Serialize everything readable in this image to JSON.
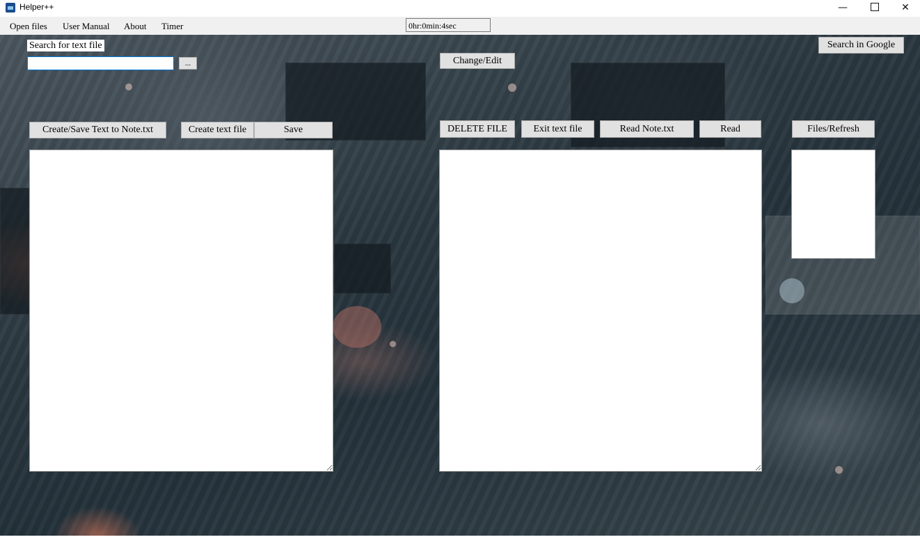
{
  "window": {
    "title": "Helper++",
    "icon": "app-icon",
    "minimize_glyph": "—",
    "close_glyph": "✕"
  },
  "menu": {
    "items": [
      "Open files",
      "User Manual",
      "About",
      "Timer"
    ],
    "timer_value": "0hr:0min:4sec"
  },
  "search": {
    "label": "Search for text file",
    "value": "",
    "browse_label": "..."
  },
  "buttons": {
    "change_edit": "Change/Edit",
    "search_google": "Search in Google",
    "create_save_note": "Create/Save Text to Note.txt",
    "create_text_file": "Create text file",
    "save": "Save",
    "delete_file": "DELETE FILE",
    "exit_text_file": "Exit text file",
    "read_note": "Read Note.txt",
    "read": "Read",
    "files_refresh": "Files/Refresh"
  },
  "editors": {
    "left_text": "",
    "right_text": "",
    "files_list": ""
  },
  "colors": {
    "menubar_bg": "#f0f0f0",
    "button_bg": "#e1e1e1",
    "input_focus_border": "#0078d7"
  }
}
